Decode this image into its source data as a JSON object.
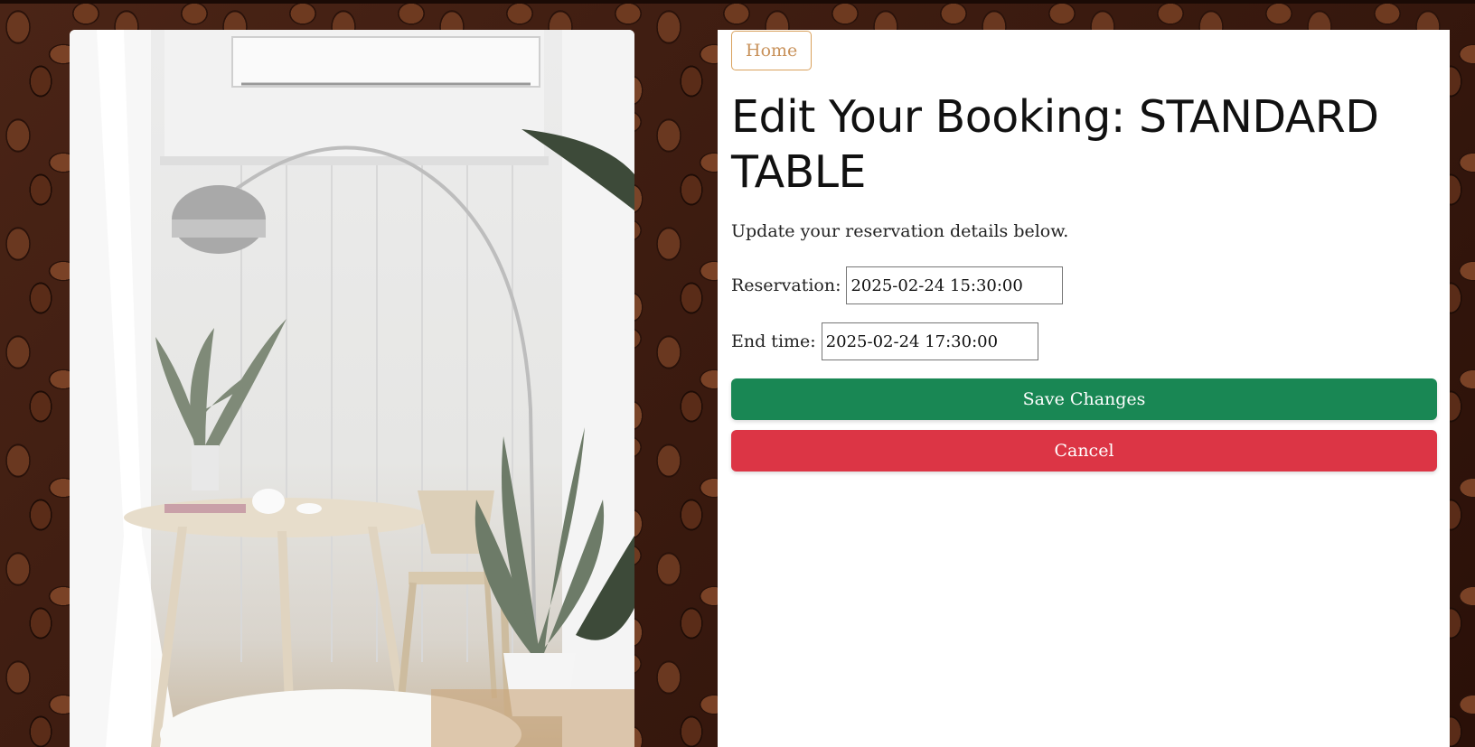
{
  "nav": {
    "home_label": "Home"
  },
  "page": {
    "title": "Edit Your Booking: STANDARD TABLE",
    "intro": "Update your reservation details below."
  },
  "form": {
    "reservation": {
      "label": "Reservation:",
      "value": "2025-02-24 15:30:00"
    },
    "end_time": {
      "label": "End time:",
      "value": "2025-02-24 17:30:00"
    },
    "save_label": "Save Changes",
    "cancel_label": "Cancel"
  },
  "colors": {
    "save_button": "#198754",
    "cancel_button": "#dc3545",
    "home_accent": "#d9a15c",
    "background": "#3a1d12"
  },
  "images": {
    "left_photo": "white-room-with-arc-lamp-table-chair-plants"
  }
}
